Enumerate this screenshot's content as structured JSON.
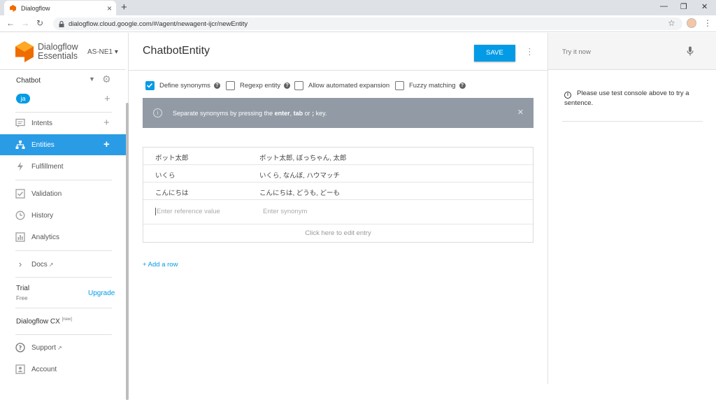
{
  "browser": {
    "tab_title": "Dialogflow",
    "url": "dialogflow.cloud.google.com/#/agent/newagent-ijcr/newEntity"
  },
  "sidebar": {
    "brand_line1": "Dialogflow",
    "brand_line2": "Essentials",
    "region": "AS-NE1 ▾",
    "agent_name": "Chatbot",
    "language": "ja",
    "items": [
      {
        "label": "Intents",
        "icon": "chat-icon"
      },
      {
        "label": "Entities",
        "icon": "sitemap-icon"
      },
      {
        "label": "Fulfillment",
        "icon": "bolt-icon"
      },
      {
        "label": "Validation",
        "icon": "checkbox-icon"
      },
      {
        "label": "History",
        "icon": "clock-icon"
      },
      {
        "label": "Analytics",
        "icon": "bar-chart-icon"
      },
      {
        "label": "Docs",
        "icon": "chevron-right-icon"
      }
    ],
    "trial_label": "Trial",
    "trial_sub": "Free",
    "upgrade_label": "Upgrade",
    "cx_label": "Dialogflow CX",
    "cx_badge": "[new]",
    "support_label": "Support",
    "account_label": "Account"
  },
  "main": {
    "title": "ChatbotEntity",
    "save_label": "SAVE",
    "options": [
      {
        "label": "Define synonyms",
        "checked": true
      },
      {
        "label": "Regexp entity",
        "checked": false
      },
      {
        "label": "Allow automated expansion",
        "checked": false
      },
      {
        "label": "Fuzzy matching",
        "checked": false
      }
    ],
    "banner": {
      "prefix": "Separate synonyms by pressing the ",
      "k1": "enter",
      "sep1": ", ",
      "k2": "tab",
      "sep2": " or ",
      "k3": ";",
      "suffix": " key."
    },
    "rows": [
      {
        "ref": "ボット太郎",
        "syn": "ボット太郎, ぼっちゃん, 太郎"
      },
      {
        "ref": "いくら",
        "syn": "いくら, なんぼ, ハウマッチ"
      },
      {
        "ref": "こんにちは",
        "syn": "こんにちは, どうも, どーも"
      }
    ],
    "ref_placeholder": "Enter reference value",
    "syn_placeholder": "Enter synonym",
    "edit_entry_label": "Click here to edit entry",
    "add_row_label": "+ Add a row"
  },
  "right": {
    "try_it_placeholder": "Try it now",
    "hint": "Please use test console above to try a sentence."
  },
  "colors": {
    "accent": "#039be5",
    "active_nav": "#2a9ce5",
    "banner_bg": "#929aa5"
  }
}
